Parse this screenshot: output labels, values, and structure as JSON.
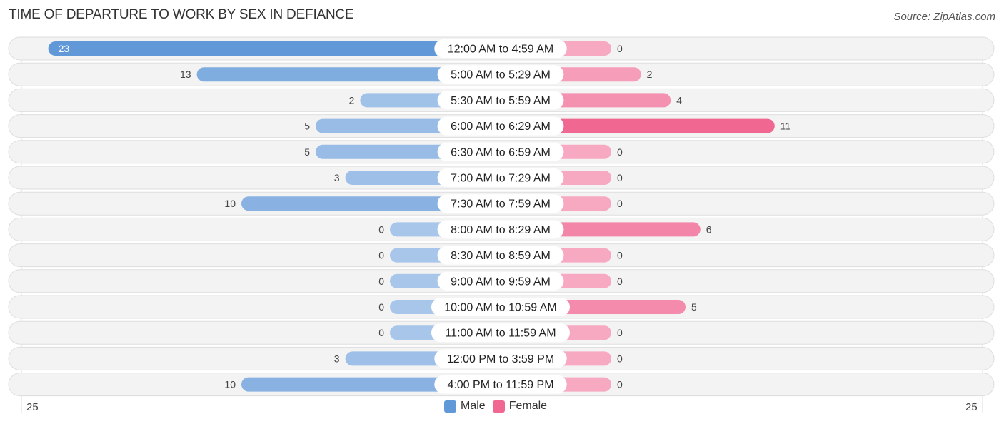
{
  "title": "TIME OF DEPARTURE TO WORK BY SEX IN DEFIANCE",
  "source": "Source: ZipAtlas.com",
  "colors": {
    "male_strong": "#6199d8",
    "male_light": "#a7c6ea",
    "female_strong": "#f06892",
    "female_light": "#f7a9c2",
    "row_bg": "#f3f3f3",
    "row_border": "#dedede"
  },
  "chart_data": {
    "type": "bar",
    "orientation": "horizontal-diverging",
    "title": "TIME OF DEPARTURE TO WORK BY SEX IN DEFIANCE",
    "categories": [
      "12:00 AM to 4:59 AM",
      "5:00 AM to 5:29 AM",
      "5:30 AM to 5:59 AM",
      "6:00 AM to 6:29 AM",
      "6:30 AM to 6:59 AM",
      "7:00 AM to 7:29 AM",
      "7:30 AM to 7:59 AM",
      "8:00 AM to 8:29 AM",
      "8:30 AM to 8:59 AM",
      "9:00 AM to 9:59 AM",
      "10:00 AM to 10:59 AM",
      "11:00 AM to 11:59 AM",
      "12:00 PM to 3:59 PM",
      "4:00 PM to 11:59 PM"
    ],
    "series": [
      {
        "name": "Male",
        "values": [
          23,
          13,
          2,
          5,
          5,
          3,
          10,
          0,
          0,
          0,
          0,
          0,
          3,
          10
        ]
      },
      {
        "name": "Female",
        "values": [
          0,
          2,
          4,
          11,
          0,
          0,
          0,
          6,
          0,
          0,
          5,
          0,
          0,
          0
        ]
      }
    ],
    "axis": {
      "left_tick": "25",
      "right_tick": "25",
      "range": [
        0,
        25
      ]
    },
    "legend": {
      "position": "bottom-center",
      "entries": [
        "Male",
        "Female"
      ]
    }
  }
}
